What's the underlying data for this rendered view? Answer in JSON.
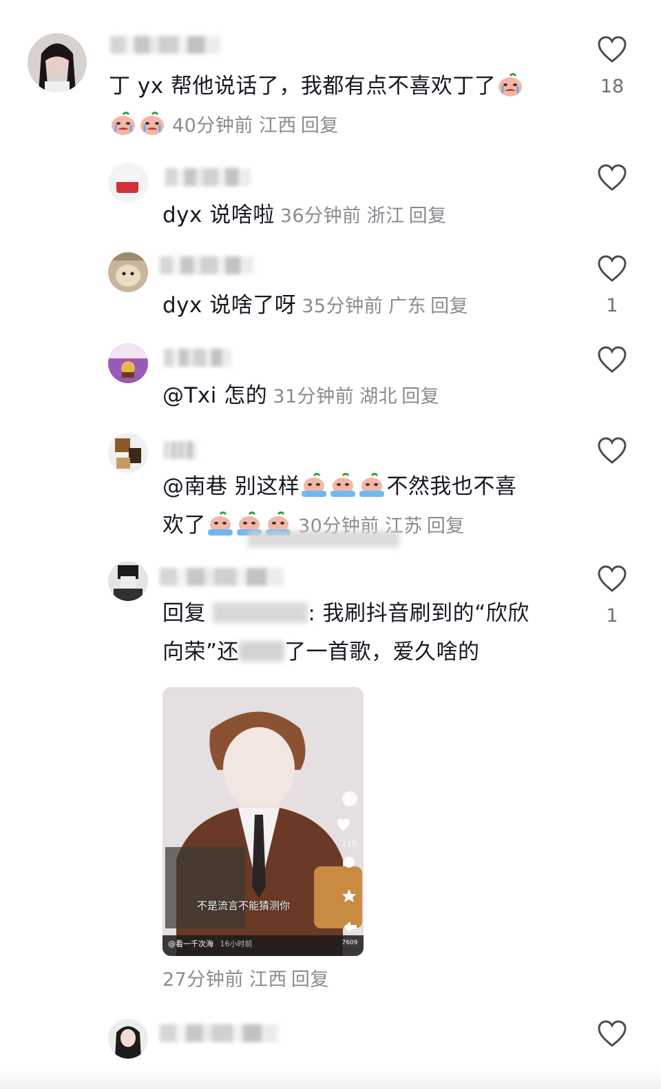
{
  "comments": [
    {
      "text": "丁 yx 帮他说话了，我都有点不喜欢丁了",
      "time": "40分钟前",
      "region": "江西",
      "reply": "回复",
      "likes": "18"
    },
    {
      "text": "dyx 说啥啦",
      "time": "36分钟前",
      "region": "浙江",
      "reply": "回复",
      "likes": ""
    },
    {
      "text": "dyx 说啥了呀",
      "time": "35分钟前",
      "region": "广东",
      "reply": "回复",
      "likes": "1"
    },
    {
      "mention": "@Txi",
      "text": "怎的",
      "time": "31分钟前",
      "region": "湖北",
      "reply": "回复",
      "likes": ""
    },
    {
      "mention": "@南巷",
      "text_a": "别这样",
      "text_b": "不然我也不喜",
      "text_c": "欢了",
      "time": "30分钟前",
      "region": "江苏",
      "reply": "回复",
      "likes": ""
    },
    {
      "prefix": "回复",
      "line1_end": ": 我刷抖音刷到的“欣欣",
      "line2": "向荣”还",
      "line2_end": "了一首歌，爱久啥的",
      "time": "27分钟前",
      "region": "江西",
      "reply": "回复",
      "likes": "1",
      "video": {
        "caption": "不是流言不能猜测你",
        "author": "@看一千次海",
        "ago": "16小时前",
        "like_count": "2.1万",
        "count_b": "7609"
      }
    }
  ],
  "colors": {
    "text": "#161823",
    "meta": "#8a8b91",
    "icon": "#4a4b52"
  }
}
